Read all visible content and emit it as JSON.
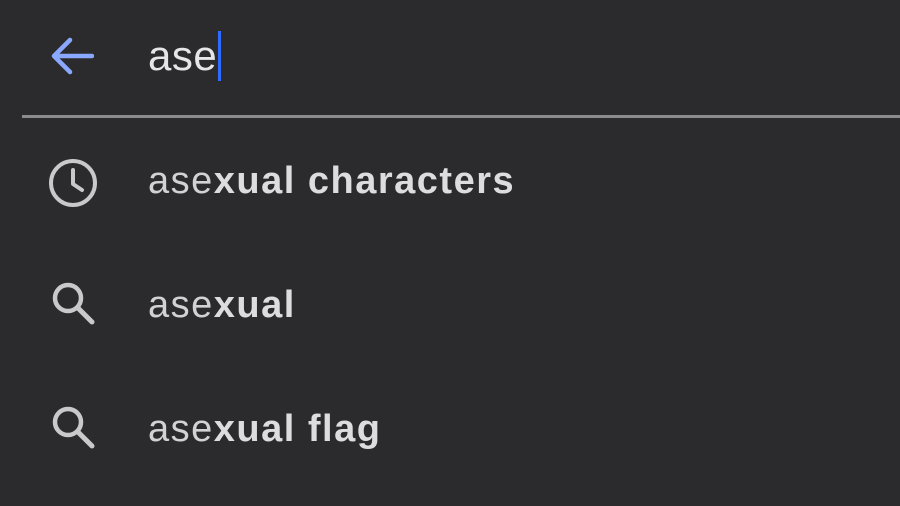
{
  "search": {
    "query": "ase",
    "back_icon": "arrow-left-icon"
  },
  "colors": {
    "background": "#2b2b2d",
    "accent": "#8aa8ff",
    "caret": "#2f6bff",
    "divider": "#8b8b8e",
    "text": "#d7d7d8"
  },
  "suggestions": [
    {
      "icon": "history-clock-icon",
      "typed": "ase",
      "completion": "xual characters"
    },
    {
      "icon": "search-icon",
      "typed": "ase",
      "completion": "xual"
    },
    {
      "icon": "search-icon",
      "typed": "ase",
      "completion": "xual flag"
    }
  ]
}
